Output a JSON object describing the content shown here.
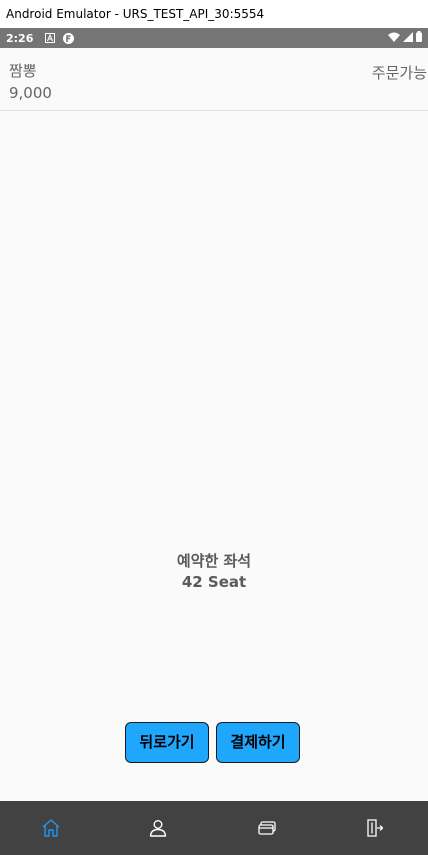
{
  "window": {
    "title": "Android Emulator - URS_TEST_API_30:5554"
  },
  "status_bar": {
    "time": "2:26",
    "icons": [
      "a-notification-icon",
      "f-notification-icon",
      "wifi-icon",
      "signal-icon",
      "battery-icon"
    ]
  },
  "menu_item": {
    "name": "짬뽕",
    "price": "9,000",
    "status": "주문가능"
  },
  "reservation": {
    "label": "예약한 좌석",
    "seat": "42 Seat"
  },
  "buttons": {
    "back_label": "뒤로가기",
    "pay_label": "결제하기"
  },
  "bottom_nav": {
    "items": [
      "home-icon",
      "person-icon",
      "card-icon",
      "exit-icon"
    ],
    "active": "home-icon"
  },
  "colors": {
    "button_bg": "#1ea7fd",
    "nav_bg": "#424242",
    "nav_active": "#2196f3",
    "nav_inactive": "#ffffff",
    "status_bar": "#757575"
  }
}
